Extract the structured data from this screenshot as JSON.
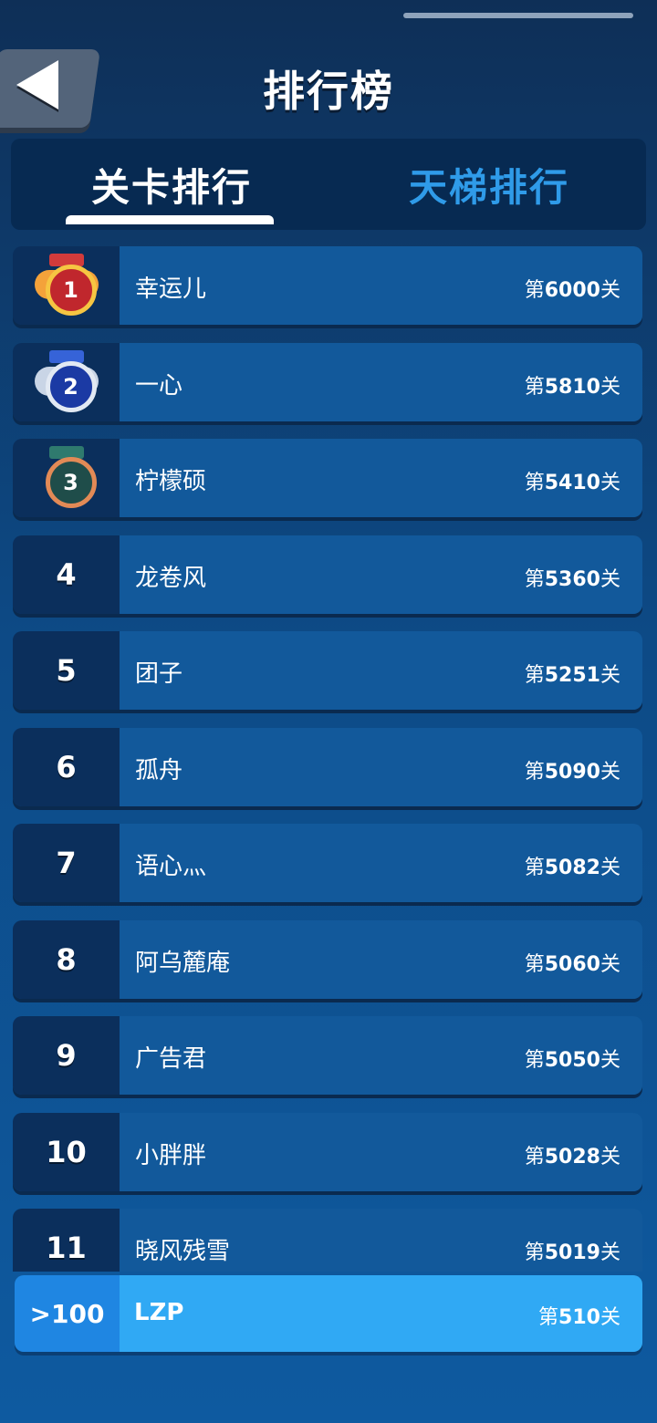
{
  "header": {
    "title": "排行榜",
    "back_icon": "back-arrow-icon"
  },
  "tabs": [
    {
      "label": "关卡排行",
      "active": true
    },
    {
      "label": "天梯排行",
      "active": false
    }
  ],
  "rows": [
    {
      "rank": "1",
      "medal": "gold-medal-icon",
      "name": "幸运儿",
      "prefix": "第",
      "level": "6000",
      "suffix": "关"
    },
    {
      "rank": "2",
      "medal": "silver-medal-icon",
      "name": "一心",
      "prefix": "第",
      "level": "5810",
      "suffix": "关"
    },
    {
      "rank": "3",
      "medal": "bronze-medal-icon",
      "name": "柠檬硕",
      "prefix": "第",
      "level": "5410",
      "suffix": "关"
    },
    {
      "rank": "4",
      "name": "龙卷风",
      "prefix": "第",
      "level": "5360",
      "suffix": "关"
    },
    {
      "rank": "5",
      "name": "团子",
      "prefix": "第",
      "level": "5251",
      "suffix": "关"
    },
    {
      "rank": "6",
      "name": "孤舟",
      "prefix": "第",
      "level": "5090",
      "suffix": "关"
    },
    {
      "rank": "7",
      "name": "语心灬",
      "prefix": "第",
      "level": "5082",
      "suffix": "关"
    },
    {
      "rank": "8",
      "name": "阿乌麓庵",
      "prefix": "第",
      "level": "5060",
      "suffix": "关"
    },
    {
      "rank": "9",
      "name": "广告君",
      "prefix": "第",
      "level": "5050",
      "suffix": "关"
    },
    {
      "rank": "10",
      "name": "小胖胖",
      "prefix": "第",
      "level": "5028",
      "suffix": "关"
    },
    {
      "rank": "11",
      "name": "晓风残雪",
      "prefix": "第",
      "level": "5019",
      "suffix": "关"
    }
  ],
  "self": {
    "rank": ">100",
    "name": "LZP",
    "prefix": "第",
    "level": "510",
    "suffix": "关"
  },
  "colors": {
    "accent": "#2f9be9",
    "self_highlight": "#30a9f4",
    "row": "#12599b"
  }
}
